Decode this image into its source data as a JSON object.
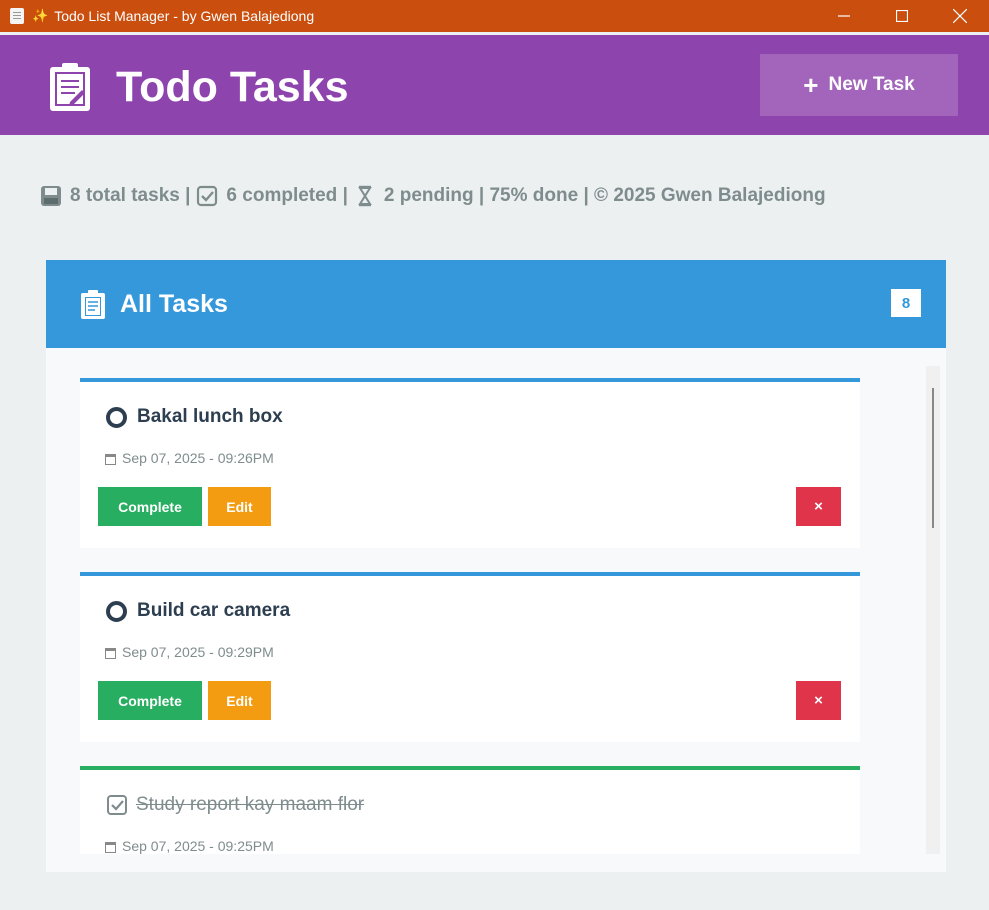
{
  "window": {
    "title": "Todo List Manager - by Gwen Balajediong",
    "sparkle_icon": "✨",
    "controls": [
      "minimize-icon",
      "maximize-icon",
      "close-icon"
    ]
  },
  "header": {
    "title": "Todo Tasks",
    "icon": "clipboard-icon",
    "new_task_label": "New Task"
  },
  "stats": {
    "total": "8 total tasks |",
    "completed": "6 completed |",
    "pending": "2 pending | 75% done | © 2025 Gwen Balajediong"
  },
  "panel": {
    "title": "All Tasks",
    "count": "8"
  },
  "tasks": [
    {
      "name": "Bakal lunch box",
      "date": "Sep 07, 2025 - 09:26PM",
      "status": "pending",
      "complete_label": "Complete",
      "edit_label": "Edit",
      "delete_label": "×"
    },
    {
      "name": "Build car camera",
      "date": "Sep 07, 2025 - 09:29PM",
      "status": "pending",
      "complete_label": "Complete",
      "edit_label": "Edit",
      "delete_label": "×"
    },
    {
      "name": "Study report kay maam flor",
      "date": "Sep 07, 2025 - 09:25PM",
      "status": "completed"
    }
  ],
  "colors": {
    "titlebar": "#ca4f0e",
    "header": "#8e44ad",
    "panel_header": "#3498db",
    "complete": "#27ae60",
    "edit": "#f39c12",
    "delete": "#e0344b"
  }
}
